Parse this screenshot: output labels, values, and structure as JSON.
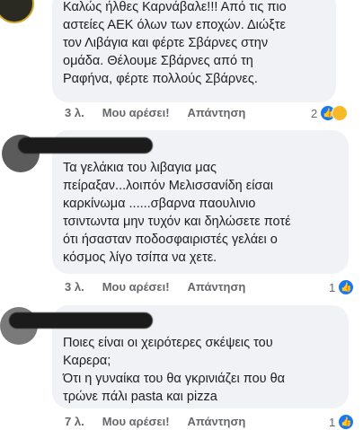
{
  "comments": [
    {
      "text": "Καλώς ήλθες Καρνάβαλε!!! Από τις πιο\nαστείες ΑΕΚ όλων των εποχών. Διώξτε\nτον Λιβάγια και φέρτε Σβάρνες στην\nομάδα. Θέλουμε Σβάρνες από τη\nΡαφήνα, φέρτε πολλούς Σβάρνες.",
      "time": "3 λ.",
      "like": "Μου αρέσει!",
      "reply": "Απάντηση",
      "reactions": "2"
    },
    {
      "text": "Τα γελάκια του λιβαγια μας\nπείραξαν...λοιπόν Μελισσανίδη είσαι\nκαρκίνωμα ......σβαρνα παουλινιο\nτσιντωντα μην τυχόν και δηλώσετε ποτέ\nότι ήσασταν ποδοσφαιριστές γελάει ο\nκόσμος λίγο τσίπα να χετε.",
      "time": "3 λ.",
      "like": "Μου αρέσει!",
      "reply": "Απάντηση",
      "reactions": "1"
    },
    {
      "text": "Ποιες είναι οι χειρότερες σκέψεις του\nΚαρερα;\nΌτι η γυναίκα του θα γκρινιάζει που θα\nτρώνε πάλι pasta και pizza",
      "time": "7 λ.",
      "like": "Μου αρέσει!",
      "reply": "Απάντηση",
      "reactions": "1"
    }
  ],
  "icons": {
    "like": "thumbs-up-icon",
    "haha": "haha-emoji-icon"
  },
  "colors": {
    "bubble": "#f0f2f5",
    "like": "#1877f2",
    "meta": "#65676b"
  }
}
